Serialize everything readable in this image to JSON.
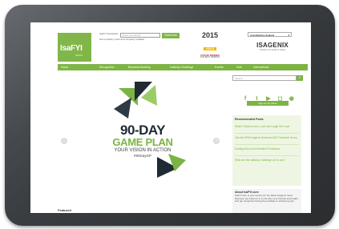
{
  "newsletter": {
    "title": "IsaFYI Newsletter",
    "subtitle": "Get company news and company updates",
    "email_placeholder": "Enter your Email",
    "subscribe_label": "Subscribe"
  },
  "logo": {
    "text": "IsaFYI",
    "sub": "NEWS"
  },
  "award": {
    "year": "2015",
    "level": "GOLD",
    "line": "STEVIE WINNER",
    "sub": "FOR BEST WEBSITE"
  },
  "region": {
    "selected": "Australia/New Zealand"
  },
  "brand": {
    "name": "ISAGENIX",
    "tagline": "Solutions for Health & Vitality"
  },
  "nav": {
    "items": [
      "Home",
      "Recognition",
      "Business Building",
      "IsaBody Challenge",
      "Events",
      "Kids",
      "International"
    ]
  },
  "hero": {
    "line1": "90-DAY",
    "line2": "GAME PLAN",
    "line3": "YOUR VISION IN ACTION",
    "hashtag": "#90DayGP"
  },
  "sidebar": {
    "search_placeholder": "Search",
    "social_icons": [
      "facebook-icon",
      "twitter-icon",
      "youtube-icon",
      "instagram-icon",
      "rss-icon"
    ],
    "signup_label": "Sign Up for Alerts",
    "recommended_title": "Recommended Posts",
    "recommended_items": [
      "What It Takes to Live, Love and Laugh Out Loud",
      "Join the NEW Isagenix Business ANZ Facebook Group",
      "Exciting New and Extended Promotions",
      "What are the IsaBody Challenge do for you?"
    ],
    "about_title": "About IsaFYI.com",
    "about_text": "IsaFYI.com is your source for the latest Isagenix news. Discover you have for it on the why your flourish and health and get recognized along the pathway to achieving your"
  },
  "featured": {
    "title": "Featured"
  },
  "colors": {
    "accent": "#7cb342",
    "frame": "#3a3d41",
    "headline": "#1f2a33"
  }
}
